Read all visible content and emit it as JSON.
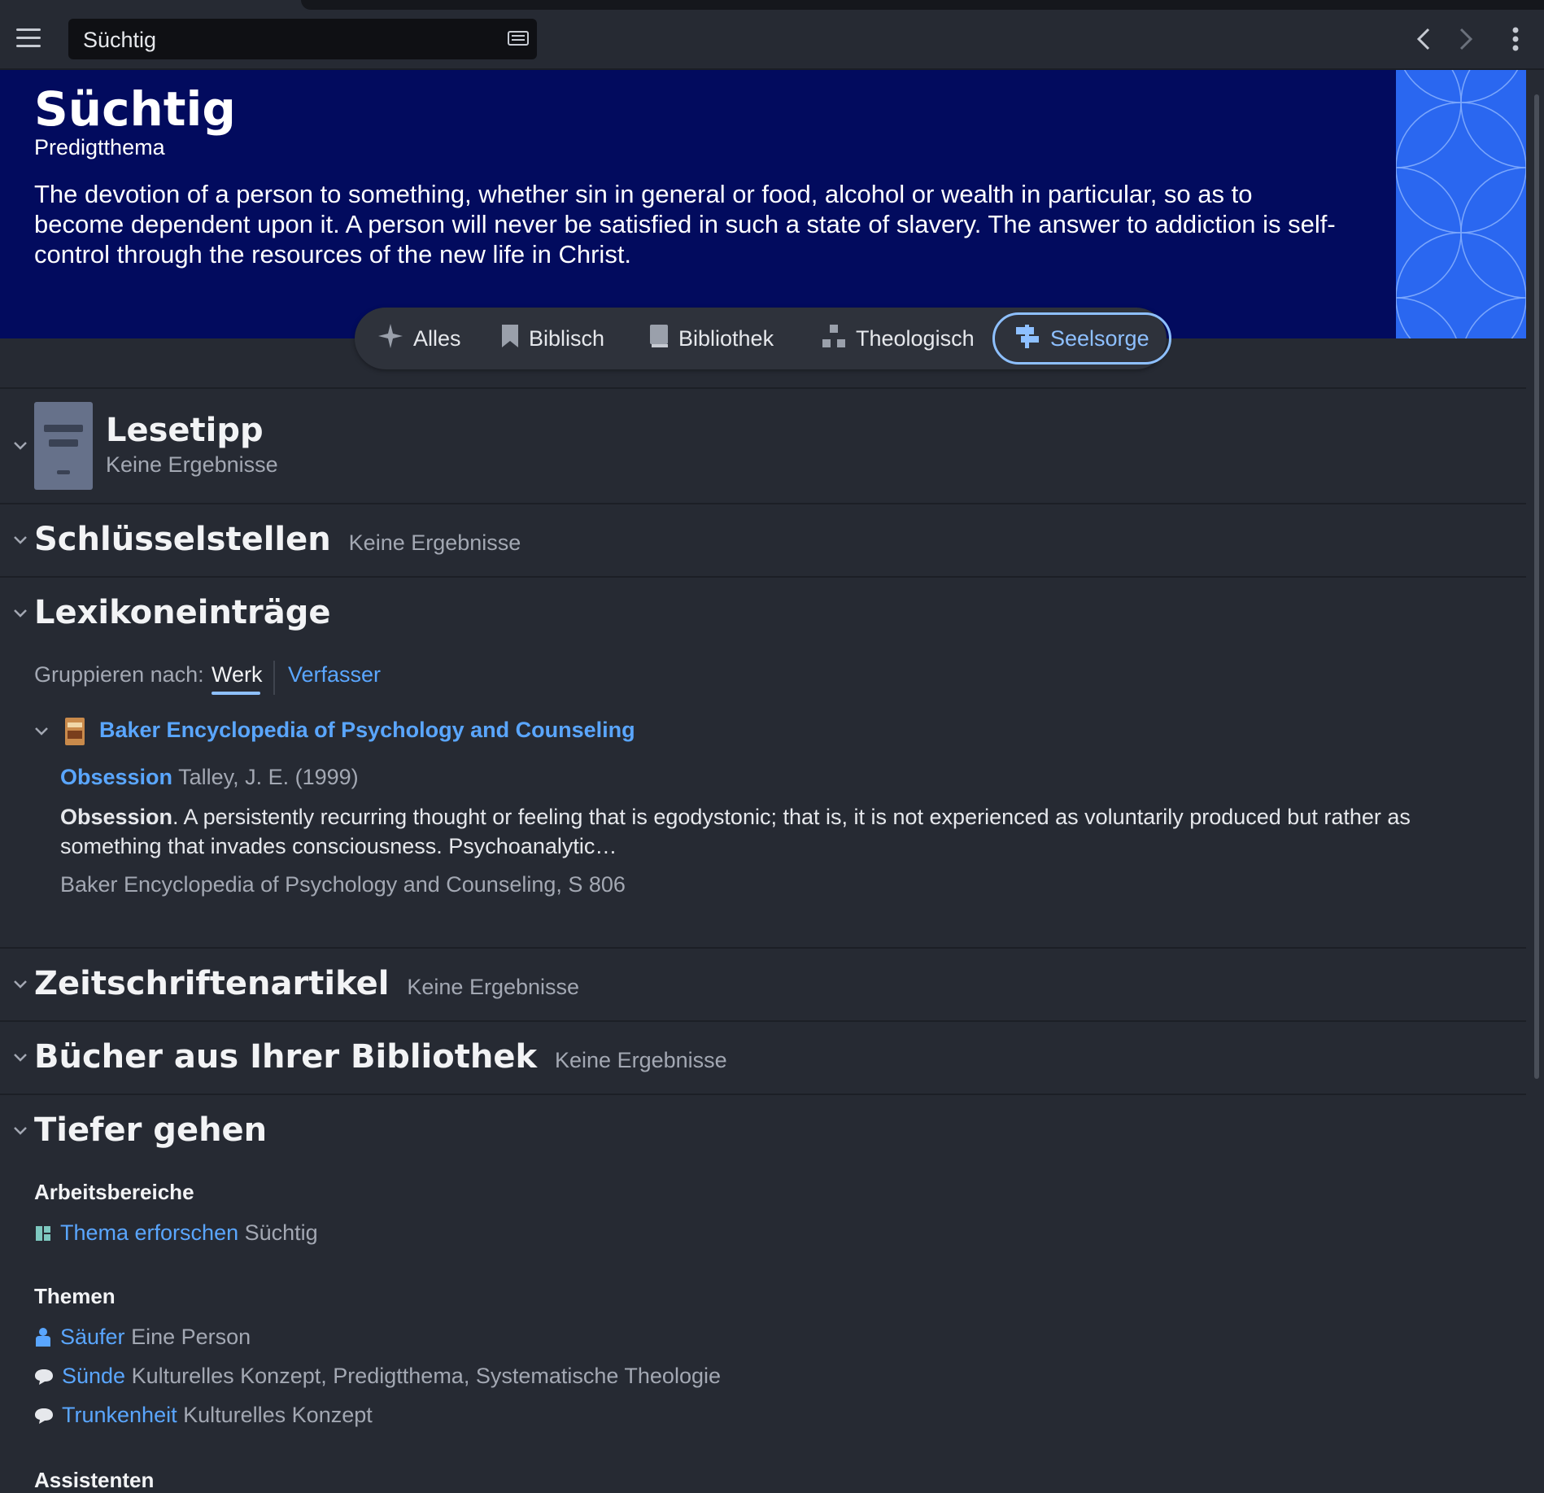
{
  "toolbar": {
    "search_value": "Süchtig",
    "menu_icon": "hamburger-icon",
    "keyboard_icon": "keyboard-icon",
    "back_icon": "chevron-left-icon",
    "forward_icon": "chevron-right-icon",
    "more_icon": "more-vertical-icon"
  },
  "hero": {
    "title": "Süchtig",
    "subtitle": "Predigtthema",
    "description": "The devotion of a person to something, whether sin in general or food, alcohol or wealth in particular, so as to become dependent upon it. A person will never be satisfied in such a state of slavery. The answer to addiction is self-control through the resources of the new life in Christ.",
    "background_color": "#020b5e",
    "art_color": "#2a67f0"
  },
  "tabs": [
    {
      "label": "Alles",
      "icon": "sparkle-icon",
      "active": false
    },
    {
      "label": "Biblisch",
      "icon": "bookmark-icon",
      "active": false
    },
    {
      "label": "Bibliothek",
      "icon": "book-icon",
      "active": false
    },
    {
      "label": "Theologisch",
      "icon": "hierarchy-icon",
      "active": false
    },
    {
      "label": "Seelsorge",
      "icon": "signpost-icon",
      "active": true
    }
  ],
  "sections": {
    "lesetipp": {
      "title": "Lesetipp",
      "status": "Keine Ergebnisse"
    },
    "schluesselstellen": {
      "title": "Schlüsselstellen",
      "status": "Keine Ergebnisse"
    },
    "lexikon": {
      "title": "Lexikoneinträge",
      "group_label": "Gruppieren nach:",
      "group_options": [
        "Werk",
        "Verfasser"
      ],
      "group_selected": "Werk",
      "work_title": "Baker Encyclopedia of Psychology and Counseling",
      "entry": {
        "title": "Obsession",
        "author": "Talley, J. E. (1999)",
        "excerpt_bold": "Obsession",
        "excerpt_rest": ". A persistently recurring thought or feeling that is egodystonic; that is, it is not experienced as voluntarily produced but rather as something that invades consciousness. Psychoanalytic…",
        "source": "Baker Encyclopedia of Psychology and Counseling, S 806"
      }
    },
    "zeitschriften": {
      "title": "Zeitschriftenartikel",
      "status": "Keine Ergebnisse"
    },
    "buecher": {
      "title": "Bücher aus Ihrer Bibliothek",
      "status": "Keine Ergebnisse"
    },
    "tiefer": {
      "title": "Tiefer gehen",
      "arbeitsbereiche_label": "Arbeitsbereiche",
      "arbeitsbereich": {
        "link": "Thema erforschen",
        "detail": "Süchtig",
        "icon": "layout-icon"
      },
      "themen_label": "Themen",
      "themen": [
        {
          "link": "Säufer",
          "detail": "Eine Person",
          "icon": "person-icon"
        },
        {
          "link": "Sünde",
          "detail": "Kulturelles Konzept, Predigtthema, Systematische Theologie",
          "icon": "speech-bubble-icon"
        },
        {
          "link": "Trunkenheit",
          "detail": "Kulturelles Konzept",
          "icon": "speech-bubble-icon"
        }
      ],
      "assistenten_label": "Assistenten"
    }
  },
  "colors": {
    "link": "#5aa6ff",
    "active_tab": "#8ec0ff",
    "background": "#262a33"
  }
}
